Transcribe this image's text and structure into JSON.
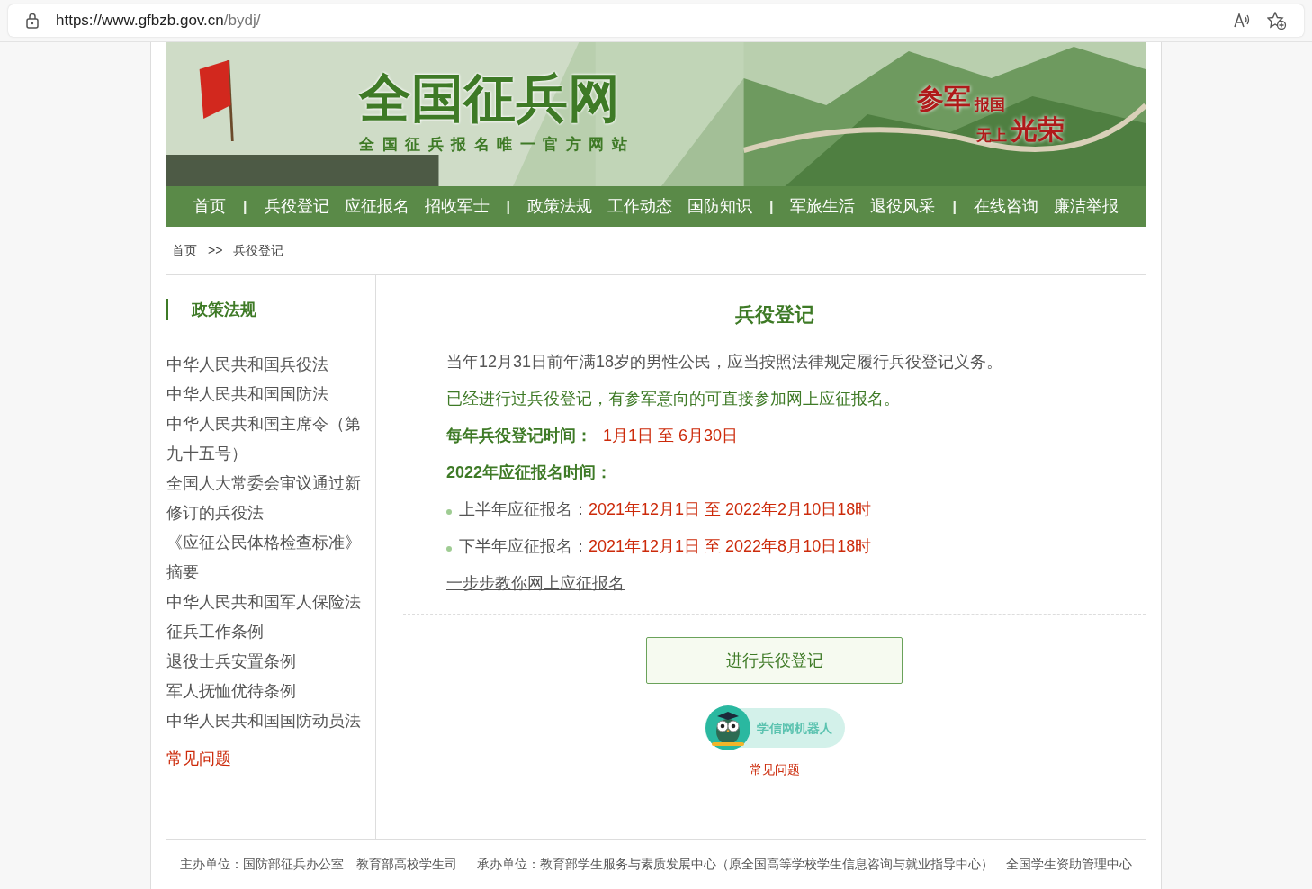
{
  "browser": {
    "url_host": "https://www.gfbzb.gov.cn",
    "url_path": "/bydj/"
  },
  "banner": {
    "title": "全国征兵网",
    "subtitle": "全国征兵报名唯一官方网站",
    "slogan_1": "参军",
    "slogan_2": "报国",
    "slogan_3": "无上",
    "slogan_4": "光荣"
  },
  "nav": [
    {
      "kind": "link",
      "label": "首页"
    },
    {
      "kind": "separator",
      "label": "|"
    },
    {
      "kind": "link",
      "label": "兵役登记"
    },
    {
      "kind": "link",
      "label": "应征报名"
    },
    {
      "kind": "link",
      "label": "招收军士"
    },
    {
      "kind": "separator",
      "label": "|"
    },
    {
      "kind": "link",
      "label": "政策法规"
    },
    {
      "kind": "link",
      "label": "工作动态"
    },
    {
      "kind": "link",
      "label": "国防知识"
    },
    {
      "kind": "separator",
      "label": "|"
    },
    {
      "kind": "link",
      "label": "军旅生活"
    },
    {
      "kind": "link",
      "label": "退役风采"
    },
    {
      "kind": "separator",
      "label": "|"
    },
    {
      "kind": "link",
      "label": "在线咨询"
    },
    {
      "kind": "link",
      "label": "廉洁举报"
    }
  ],
  "breadcrumb": {
    "home": "首页",
    "separator": ">>",
    "current": "兵役登记"
  },
  "sidebar": {
    "heading": "政策法规",
    "items": [
      "中华人民共和国兵役法",
      "中华人民共和国国防法",
      "中华人民共和国主席令（第九十五号）",
      "全国人大常委会审议通过新修订的兵役法",
      "《应征公民体格检查标准》摘要",
      "中华人民共和国军人保险法",
      "征兵工作条例",
      "退役士兵安置条例",
      "军人抚恤优待条例",
      "中华人民共和国国防动员法"
    ],
    "faq": "常见问题"
  },
  "main": {
    "title": "兵役登记",
    "para_1": "当年12月31日前年满18岁的男性公民，应当按照法律规定履行兵役登记义务。",
    "para_2": "已经进行过兵役登记，有参军意向的可直接参加网上应征报名。",
    "reg_label": "每年兵役登记时间：",
    "reg_value": "1月1日 至 6月30日",
    "enlist_heading": "2022年应征报名时间：",
    "periods": [
      {
        "label": "上半年应征报名：",
        "value": "2021年12月1日 至 2022年2月10日18时"
      },
      {
        "label": "下半年应征报名：",
        "value": "2021年12月1日 至 2022年8月10日18时"
      }
    ],
    "guide_link": "一步步教你网上应征报名",
    "button": "进行兵役登记",
    "robot": "学信网机器人",
    "faq": "常见问题"
  },
  "footer": {
    "host": "主办单位：国防部征兵办公室　教育部高校学生司",
    "organizer": "承办单位：教育部学生服务与素质发展中心（原全国高等学校学生信息咨询与就业指导中心）　全国学生资助管理中心"
  }
}
